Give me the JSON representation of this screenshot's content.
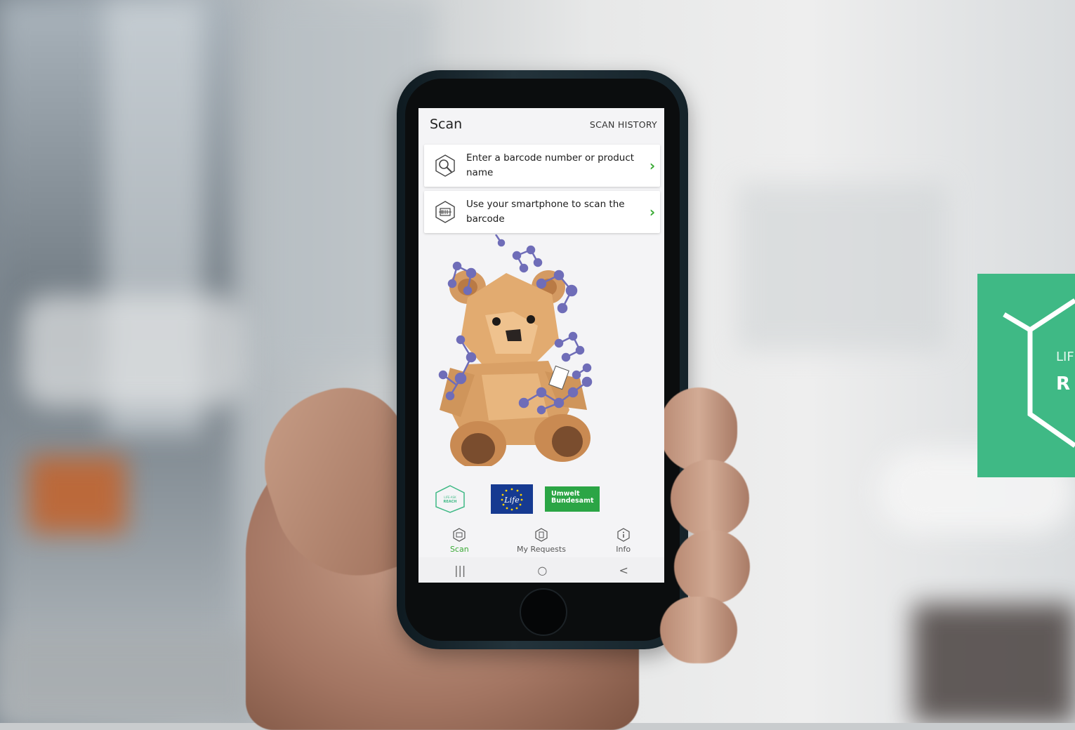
{
  "app": {
    "title": "Scan",
    "history_label": "SCAN HISTORY"
  },
  "options": [
    {
      "icon": "search-magnifier-icon",
      "label": "Enter a barcode number or product name"
    },
    {
      "icon": "barcode-scan-icon",
      "label": "Use your smartphone to scan the barcode"
    }
  ],
  "logos": {
    "life_reach": "LIFE · AskREACH",
    "eu": "Life",
    "uba_line1": "Umwelt",
    "uba_line2": "Bundesamt"
  },
  "tabs": [
    {
      "label": "Scan",
      "icon": "scan-icon",
      "active": true
    },
    {
      "label": "My Requests",
      "icon": "requests-icon",
      "active": false
    },
    {
      "label": "Info",
      "icon": "info-icon",
      "active": false
    }
  ],
  "system_nav": {
    "recents": "|||",
    "home": "○",
    "back": "<"
  },
  "banner": {
    "line1": "LIF",
    "line2": "R"
  },
  "colors": {
    "accent_green": "#3aaa35",
    "banner_green": "#3fb985",
    "eu_blue": "#163a91"
  }
}
